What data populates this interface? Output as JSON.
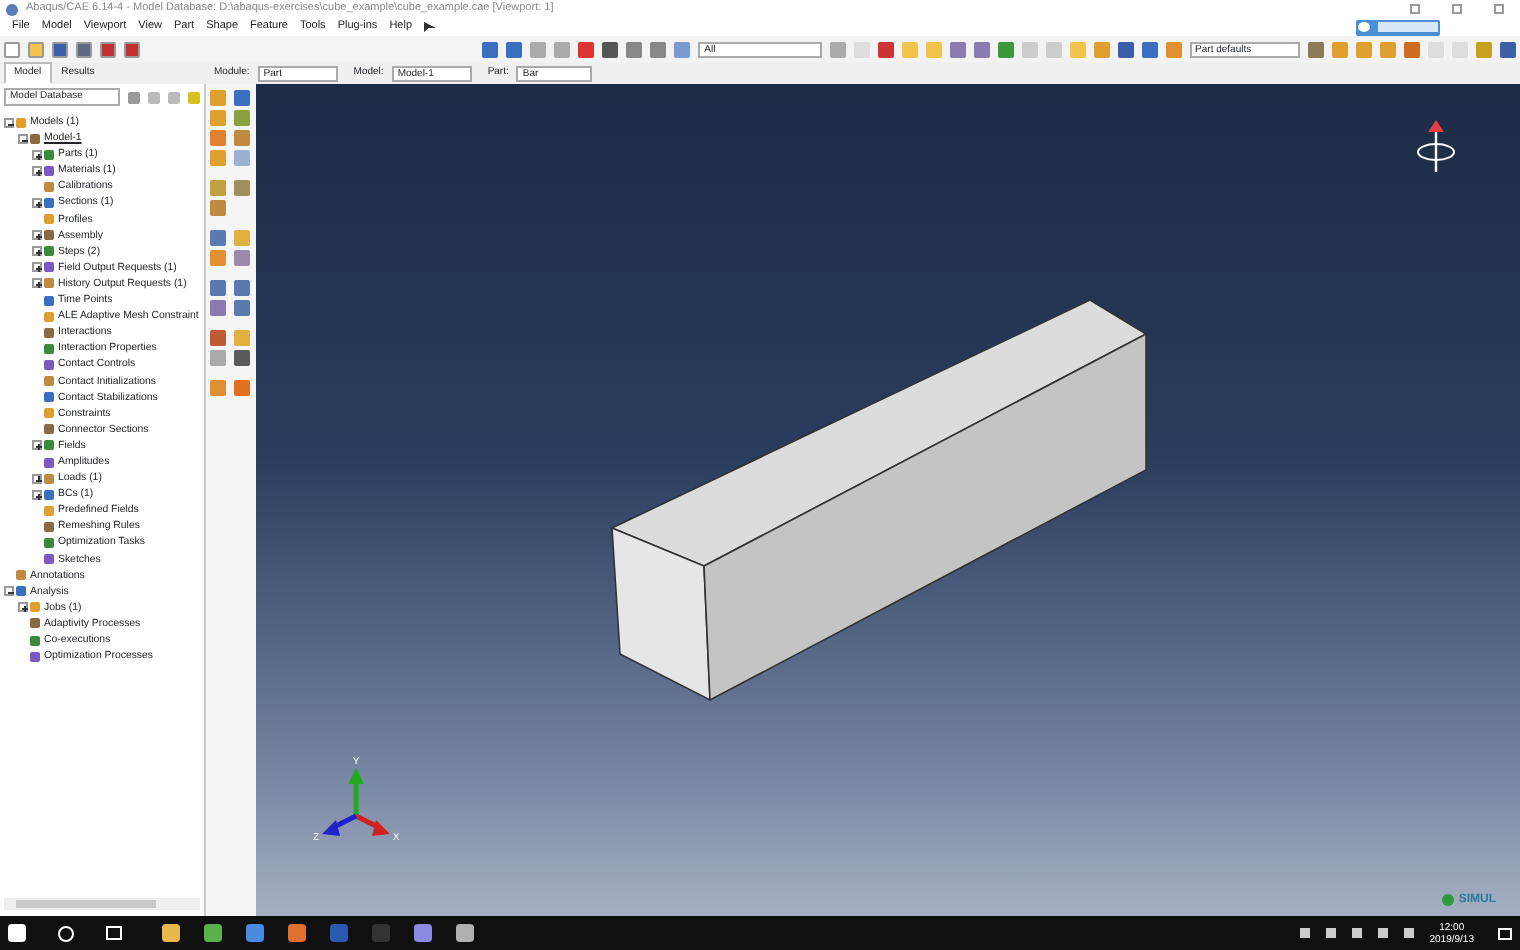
{
  "window": {
    "title": "Abaqus/CAE 6.14-4 - Model Database: D:\\abaqus-exercises\\cube_example\\cube_example.cae [Viewport: 1]"
  },
  "menu": [
    "File",
    "Model",
    "Viewport",
    "View",
    "Part",
    "Shape",
    "Feature",
    "Tools",
    "Plug-ins",
    "Help"
  ],
  "toolbar": {
    "selection_filter": "All",
    "display_group": "Part defaults"
  },
  "tabs": [
    {
      "label": "Model",
      "selected": true
    },
    {
      "label": "Results",
      "selected": false
    }
  ],
  "context": [
    {
      "label": "Module:",
      "value": "Part"
    },
    {
      "label": "Model:",
      "value": "Model-1"
    },
    {
      "label": "Part:",
      "value": "Bar"
    }
  ],
  "tree": {
    "source": "Model Database",
    "items": [
      {
        "label": "Models (1)",
        "expanded": true,
        "children": [
          {
            "label": "Model-1",
            "expanded": true,
            "current": true,
            "children": [
              {
                "label": "Parts (1)",
                "expanded": false
              },
              {
                "label": "Materials (1)",
                "expanded": false
              },
              {
                "label": "Calibrations"
              },
              {
                "label": "Sections (1)",
                "expanded": false
              },
              {
                "label": "Profiles"
              },
              {
                "label": "Assembly",
                "expanded": false
              },
              {
                "label": "Steps (2)",
                "expanded": false
              },
              {
                "label": "Field Output Requests (1)",
                "expanded": false
              },
              {
                "label": "History Output Requests (1)",
                "expanded": false
              },
              {
                "label": "Time Points"
              },
              {
                "label": "ALE Adaptive Mesh Constraint"
              },
              {
                "label": "Interactions"
              },
              {
                "label": "Interaction Properties"
              },
              {
                "label": "Contact Controls"
              },
              {
                "label": "Contact Initializations"
              },
              {
                "label": "Contact Stabilizations"
              },
              {
                "label": "Constraints"
              },
              {
                "label": "Connector Sections"
              },
              {
                "label": "Fields",
                "expanded": false
              },
              {
                "label": "Amplitudes"
              },
              {
                "label": "Loads (1)",
                "expanded": false
              },
              {
                "label": "BCs (1)",
                "expanded": false
              },
              {
                "label": "Predefined Fields"
              },
              {
                "label": "Remeshing Rules"
              },
              {
                "label": "Optimization Tasks"
              },
              {
                "label": "Sketches"
              }
            ]
          }
        ]
      },
      {
        "label": "Annotations"
      },
      {
        "label": "Analysis",
        "expanded": true,
        "children": [
          {
            "label": "Jobs (1)",
            "expanded": false
          },
          {
            "label": "Adaptivity Processes"
          },
          {
            "label": "Co-executions"
          },
          {
            "label": "Optimization Processes"
          }
        ]
      }
    ]
  },
  "viewport": {
    "brand": "SIMUL",
    "triad": [
      "Y",
      "Z",
      "X"
    ]
  },
  "taskbar": {
    "time": "12:00",
    "date": "2019/9/13"
  }
}
